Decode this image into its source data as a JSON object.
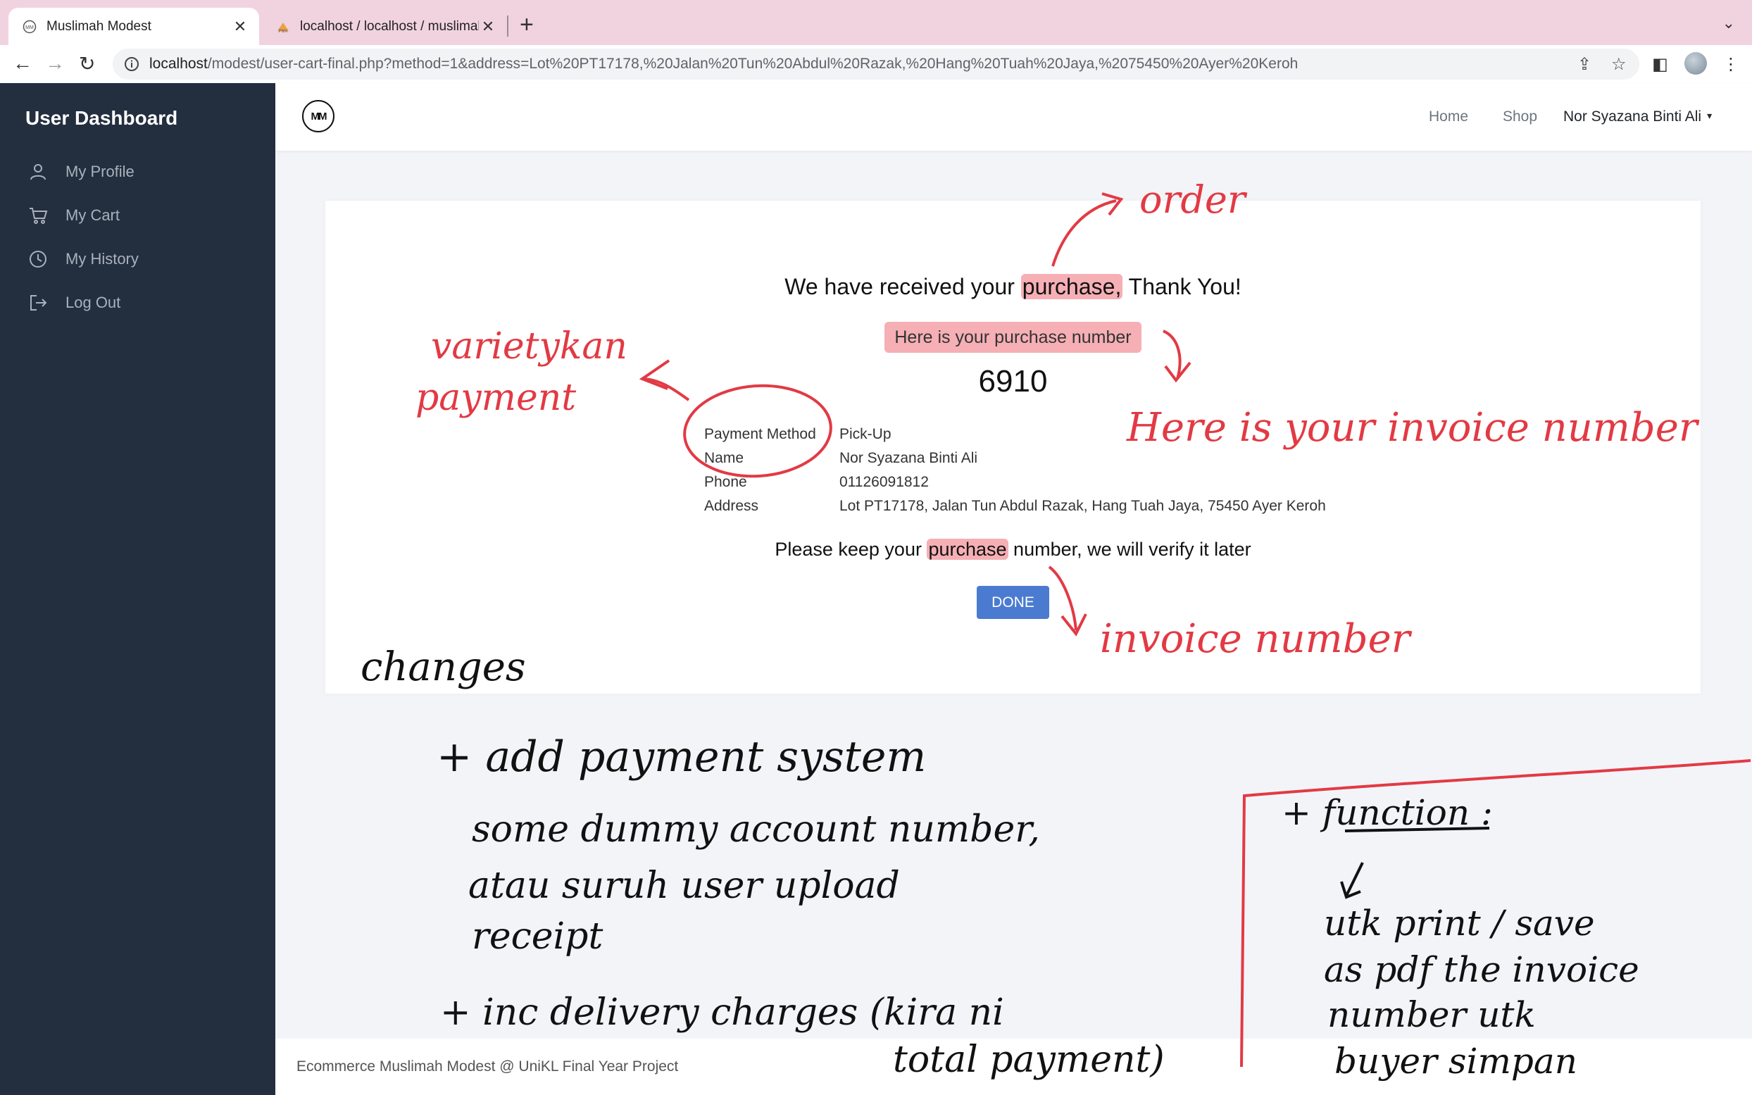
{
  "browser": {
    "tabs": [
      {
        "title": "Muslimah Modest",
        "active": true
      },
      {
        "title": "localhost / localhost / muslimah",
        "active": false
      }
    ],
    "url_host": "localhost",
    "url_rest": "/modest/user-cart-final.php?method=1&address=Lot%20PT17178,%20Jalan%20Tun%20Abdul%20Razak,%20Hang%20Tuah%20Jaya,%2075450%20Ayer%20Keroh"
  },
  "sidebar": {
    "title": "User Dashboard",
    "items": [
      {
        "label": "My Profile",
        "icon": "user-icon"
      },
      {
        "label": "My Cart",
        "icon": "cart-icon"
      },
      {
        "label": "My History",
        "icon": "clock-icon"
      },
      {
        "label": "Log Out",
        "icon": "logout-icon"
      }
    ]
  },
  "topnav": {
    "logo_text": "MM",
    "home": "Home",
    "shop": "Shop",
    "user": "Nor Syazana Binti Ali"
  },
  "confirmation": {
    "thanks_before": "We have received your ",
    "thanks_hl": "purchase,",
    "thanks_after": " Thank You!",
    "sub": "Here is your purchase number",
    "number": "6910",
    "details": [
      {
        "key": "Payment Method",
        "value": "Pick-Up"
      },
      {
        "key": "Name",
        "value": "Nor Syazana Binti Ali"
      },
      {
        "key": "Phone",
        "value": "01126091812"
      },
      {
        "key": "Address",
        "value": "Lot PT17178, Jalan Tun Abdul Razak, Hang Tuah Jaya, 75450 Ayer Keroh"
      }
    ],
    "keep_before": "Please keep your ",
    "keep_hl": "purchase",
    "keep_after": " number, we will verify it later",
    "done": "DONE"
  },
  "footer": "Ecommerce Muslimah Modest @ UniKL Final Year Project",
  "annotations": {
    "order": "order",
    "variety_1": "varietykan",
    "variety_2": "payment",
    "here_invoice": "Here is your invoice number",
    "invoice_number": "invoice number",
    "changes": "changes",
    "add_payment": "+ add payment system",
    "dummy_1": "some dummy account number,",
    "dummy_2": "atau suruh user upload",
    "dummy_3": "receipt",
    "inc_delivery": "+ inc delivery charges (kira ni",
    "total_payment": "total payment)",
    "function": "+ function :",
    "fn_1": "utk print / save",
    "fn_2": "as pdf the invoice",
    "fn_3": "number utk",
    "fn_4": "buyer simpan"
  },
  "colors": {
    "sidebar_bg": "#232e3e",
    "tabbar_bg": "#f1d3df",
    "primary_button": "#4a7bd0",
    "annotation_red": "#e23a44"
  }
}
